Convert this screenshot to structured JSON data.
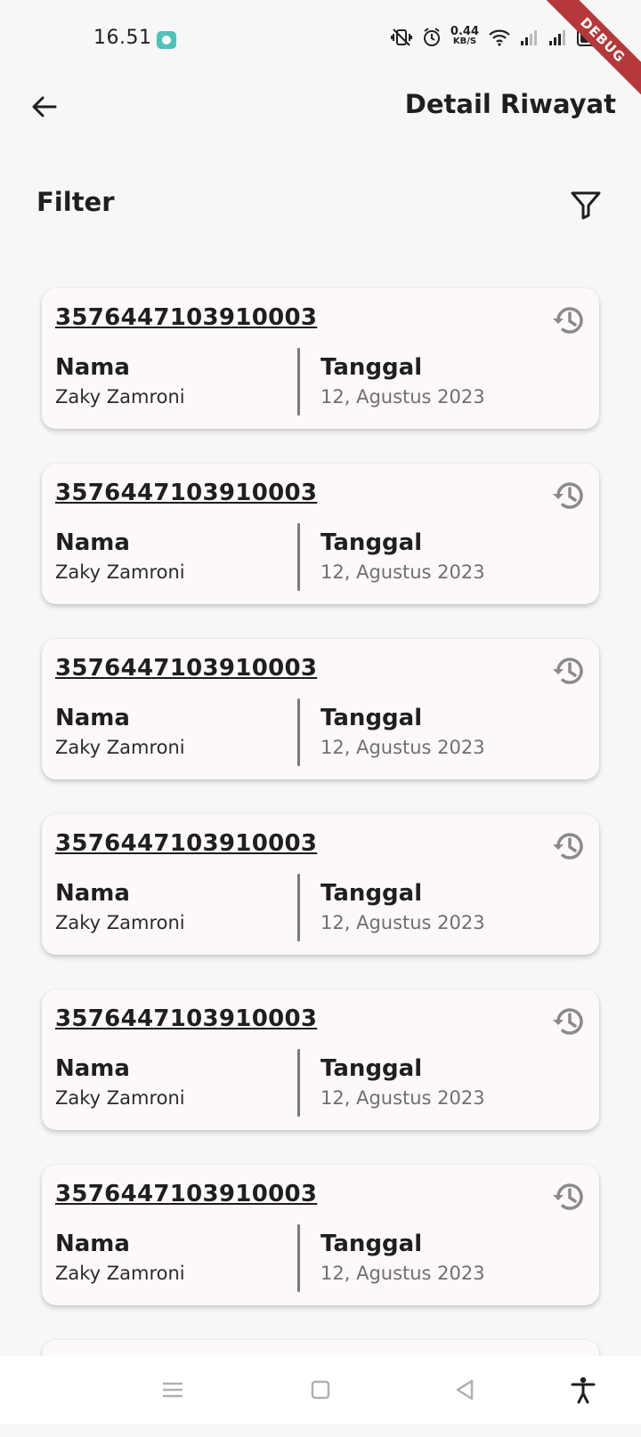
{
  "status_bar": {
    "time": "16.51",
    "net_speed_value": "0.44",
    "net_speed_unit": "KB/S",
    "debug_banner": "DEBUG",
    "icons": [
      "notification-app-icon",
      "vibrate-off-icon",
      "alarm-icon",
      "wifi-icon",
      "signal-icon",
      "signal-icon",
      "battery-icon"
    ]
  },
  "app_bar": {
    "back_icon": "arrow-left-icon",
    "title": "Detail Riwayat"
  },
  "filter": {
    "label": "Filter",
    "icon": "filter-funnel-icon"
  },
  "records": [
    {
      "id": "3576447103910003",
      "name_label": "Nama",
      "name": "Zaky Zamroni",
      "date_label": "Tanggal",
      "date": "12, Agustus 2023"
    },
    {
      "id": "3576447103910003",
      "name_label": "Nama",
      "name": "Zaky Zamroni",
      "date_label": "Tanggal",
      "date": "12, Agustus 2023"
    },
    {
      "id": "3576447103910003",
      "name_label": "Nama",
      "name": "Zaky Zamroni",
      "date_label": "Tanggal",
      "date": "12, Agustus 2023"
    },
    {
      "id": "3576447103910003",
      "name_label": "Nama",
      "name": "Zaky Zamroni",
      "date_label": "Tanggal",
      "date": "12, Agustus 2023"
    },
    {
      "id": "3576447103910003",
      "name_label": "Nama",
      "name": "Zaky Zamroni",
      "date_label": "Tanggal",
      "date": "12, Agustus 2023"
    },
    {
      "id": "3576447103910003",
      "name_label": "Nama",
      "name": "Zaky Zamroni",
      "date_label": "Tanggal",
      "date": "12, Agustus 2023"
    }
  ],
  "nav_bar": {
    "items": [
      "menu-icon",
      "home-square-icon",
      "back-triangle-icon",
      "accessibility-icon"
    ]
  },
  "colors": {
    "background": "#f7f7f8",
    "card": "#fdf8fb",
    "text": "#1f1f1f",
    "secondary_text": "#707070",
    "icon_gray": "#8a8a8a",
    "debug_ribbon": "#b5383a",
    "app_badge": "#4fc3b8"
  }
}
